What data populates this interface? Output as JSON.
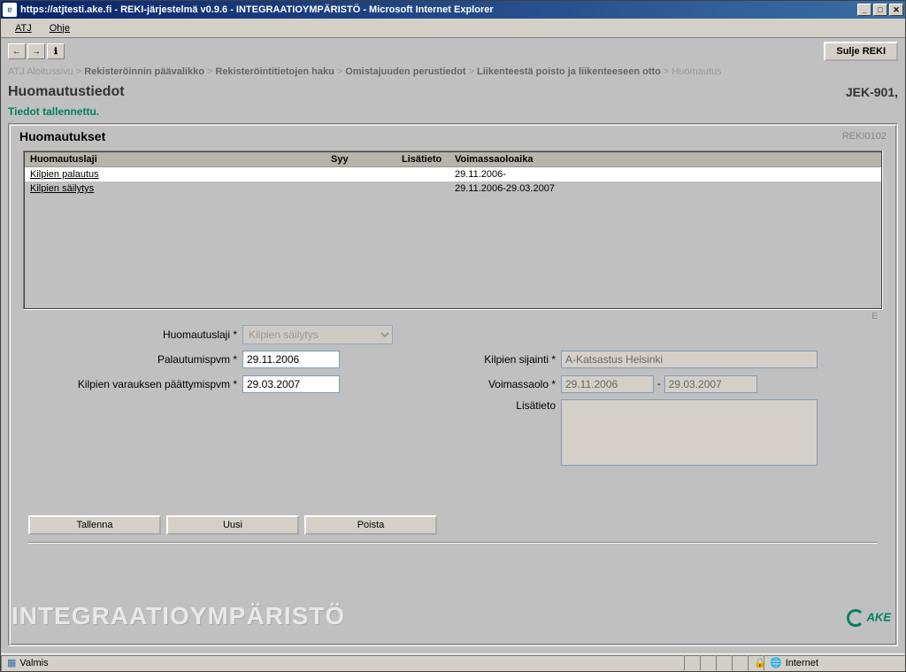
{
  "window": {
    "title": "https://atjtesti.ake.fi - REKI-järjestelmä v0.9.6 - INTEGRAATIOYMPÄRISTÖ - Microsoft Internet Explorer"
  },
  "menu": {
    "atj": "ATJ",
    "ohje": "Ohje"
  },
  "nav": {
    "back": "←",
    "fwd": "→",
    "info": "ℹ"
  },
  "button": {
    "sulje": "Sulje REKI",
    "tallenna": "Tallenna",
    "uusi": "Uusi",
    "poista": "Poista"
  },
  "breadcrumb": {
    "b0": "ATJ Aloitussivu",
    "b1": "Rekisteröinnin päävalikko",
    "b2": "Rekisteröintitietojen haku",
    "b3": "Omistajuuden perustiedot",
    "b4": "Liikenteestä poisto ja liikenteeseen otto",
    "b5": "Huomautus"
  },
  "page": {
    "title": "Huomautustiedot",
    "code": "JEK-901,"
  },
  "status_msg": "Tiedot tallennettu.",
  "panel": {
    "title": "Huomautukset",
    "code": "REKI0102"
  },
  "table": {
    "h0": "Huomautuslaji",
    "h1": "Syy",
    "h2": "Lisätieto",
    "h3": "Voimassaoloaika",
    "rows": [
      {
        "laji": "Kilpien palautus",
        "syy": "",
        "lisa": "",
        "aika": "29.11.2006-"
      },
      {
        "laji": "Kilpien säilytys",
        "syy": "",
        "lisa": "",
        "aika": "29.11.2006-29.03.2007"
      }
    ]
  },
  "labels": {
    "huomautuslaji": "Huomautuslaji *",
    "palautumispvm": "Palautumispvm *",
    "varaus": "Kilpien varauksen päättymispvm *",
    "sijainti": "Kilpien sijainti *",
    "voimassaolo": "Voimassaolo *",
    "lisatieto": "Lisätieto"
  },
  "form": {
    "huomautuslaji": "Kilpien säilytys",
    "palautumispvm": "29.11.2006",
    "varaus": "29.03.2007",
    "sijainti": "A-Katsastus Helsinki",
    "voimassa_alku": "29.11.2006",
    "voimassa_loppu": "29.03.2007",
    "lisatieto": ""
  },
  "edit_marker": "E",
  "watermark": "INTEGRAATIOYMPÄRISTÖ",
  "logo": "AKE",
  "statusbar": {
    "ready": "Valmis",
    "zone": "Internet"
  }
}
